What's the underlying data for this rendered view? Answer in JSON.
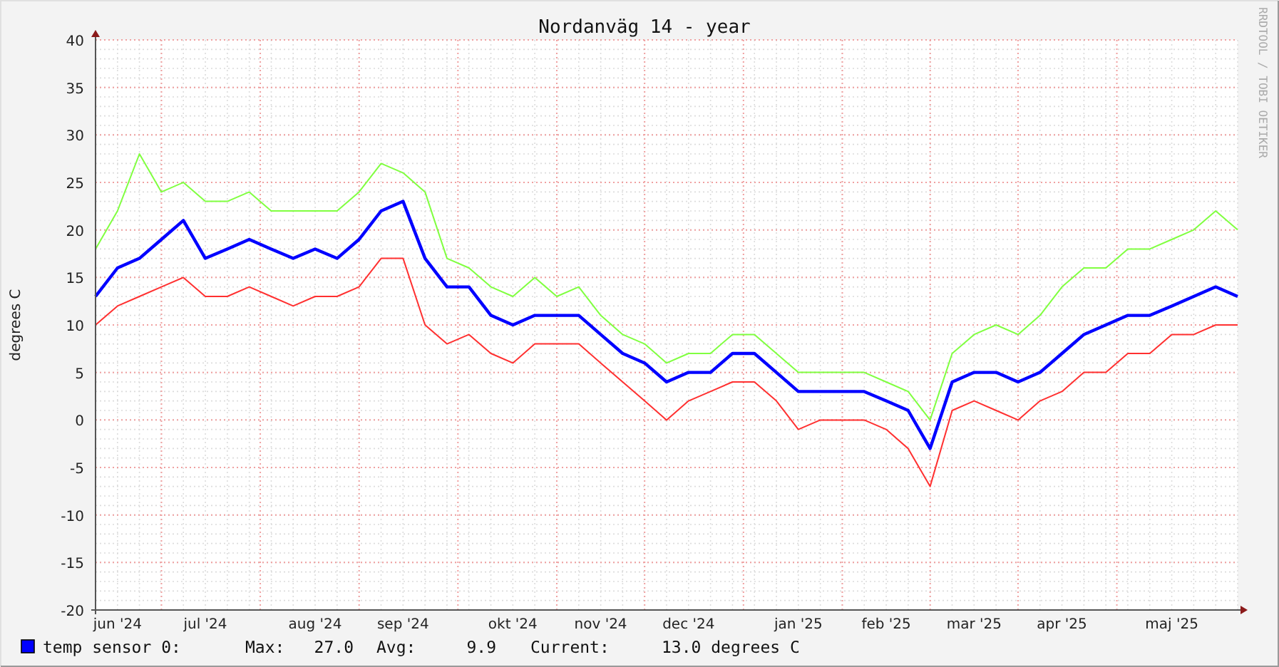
{
  "title": "Nordanväg 14 - year",
  "watermark": "RRDTOOL / TOBI OETIKER",
  "chart_data": {
    "type": "line",
    "ylabel": "degrees C",
    "categories": [
      null,
      "jun '24",
      null,
      null,
      null,
      "jul '24",
      null,
      null,
      null,
      null,
      "aug '24",
      null,
      null,
      null,
      "sep '24",
      null,
      null,
      null,
      null,
      "okt '24",
      null,
      null,
      null,
      "nov '24",
      null,
      null,
      null,
      "dec '24",
      null,
      null,
      null,
      null,
      "jan '25",
      null,
      null,
      null,
      "feb '25",
      null,
      null,
      null,
      "mar '25",
      null,
      null,
      null,
      "apr '25",
      null,
      null,
      null,
      null,
      "maj '25",
      null,
      null,
      null
    ],
    "ylim": [
      -20,
      40
    ],
    "grid": true,
    "yticks": [
      -20,
      -15,
      -10,
      -5,
      0,
      5,
      10,
      15,
      20,
      25,
      30,
      35,
      40
    ],
    "series": [
      {
        "color": "#80ff40",
        "values": [
          18,
          22,
          28,
          24,
          25,
          23,
          23,
          24,
          22,
          22,
          22,
          22,
          24,
          27,
          26,
          24,
          17,
          16,
          14,
          13,
          15,
          13,
          14,
          11,
          9,
          8,
          6,
          7,
          7,
          9,
          9,
          7,
          5,
          5,
          5,
          5,
          4,
          3,
          0,
          7,
          9,
          10,
          9,
          11,
          14,
          16,
          16,
          18,
          18,
          19,
          20,
          22,
          20
        ]
      },
      {
        "color": "#ff3030",
        "values": [
          10,
          12,
          13,
          14,
          15,
          13,
          13,
          14,
          13,
          12,
          13,
          13,
          14,
          17,
          17,
          10,
          8,
          9,
          7,
          6,
          8,
          8,
          8,
          6,
          4,
          2,
          0,
          2,
          3,
          4,
          4,
          2,
          -1,
          0,
          0,
          0,
          -1,
          -3,
          -7,
          1,
          2,
          1,
          0,
          2,
          3,
          5,
          5,
          7,
          7,
          9,
          9,
          10,
          10
        ]
      },
      {
        "name": "temp sensor 0",
        "color": "#0000ff",
        "values": [
          13,
          16,
          17,
          19,
          21,
          17,
          18,
          19,
          18,
          17,
          18,
          17,
          19,
          22,
          23,
          17,
          14,
          14,
          11,
          10,
          11,
          11,
          11,
          9,
          7,
          6,
          4,
          5,
          5,
          7,
          7,
          5,
          3,
          3,
          3,
          3,
          2,
          1,
          -3,
          4,
          5,
          5,
          4,
          5,
          7,
          9,
          10,
          11,
          11,
          12,
          13,
          14,
          13
        ]
      }
    ]
  },
  "legend": {
    "separator": ":",
    "stats": [
      {
        "label": "Max:",
        "value": "27.0"
      },
      {
        "label": "Avg:",
        "value": "9.9"
      },
      {
        "label": "Current:",
        "value": "13.0 degrees C"
      }
    ]
  }
}
